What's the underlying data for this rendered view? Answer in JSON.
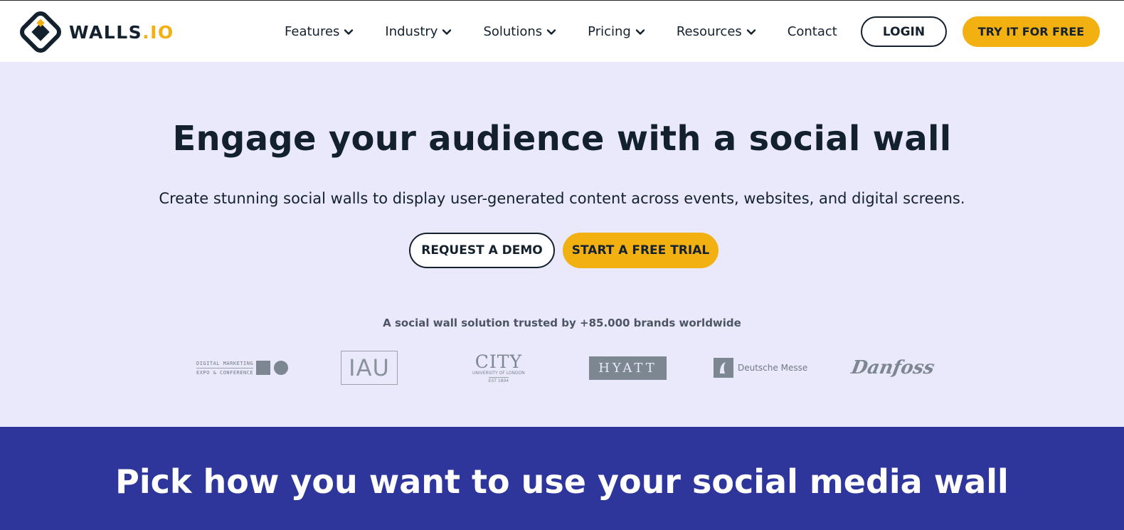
{
  "header": {
    "logo_name": "WALLS",
    "logo_suffix": ".IO",
    "nav": [
      {
        "label": "Features",
        "icon": "chevron-down-icon"
      },
      {
        "label": "Industry",
        "icon": "chevron-down-icon"
      },
      {
        "label": "Solutions",
        "icon": "chevron-down-icon"
      },
      {
        "label": "Pricing",
        "icon": "chevron-down-icon"
      },
      {
        "label": "Resources",
        "icon": "chevron-down-icon"
      },
      {
        "label": "Contact"
      }
    ],
    "login_label": "LOGIN",
    "try_label": "TRY IT FOR FREE"
  },
  "hero": {
    "title": "Engage your audience with a social wall",
    "subtitle": "Create stunning social walls to display user-generated content across events, websites, and digital screens.",
    "demo_label": "REQUEST A DEMO",
    "trial_label": "START A FREE TRIAL",
    "trusted_text": "A social wall solution trusted by +85.000 brands worldwide",
    "brands": {
      "dmexco_line1": "DIGITAL MARKETING",
      "dmexco_line2": "EXPO & CONFERENCE",
      "iau": "IAU",
      "city": "CITY",
      "city_sub": "UNIVERSITY OF LONDON",
      "city_est": "EST 1894",
      "hyatt": "HYATT",
      "messe": "Deutsche Messe",
      "danfoss": "Danfoss"
    }
  },
  "band": {
    "title": "Pick how you want to use your social media wall"
  },
  "colors": {
    "accent": "#f2b011",
    "hero_bg": "#eae9fb",
    "band_bg": "#2f369b",
    "text": "#13212e"
  }
}
